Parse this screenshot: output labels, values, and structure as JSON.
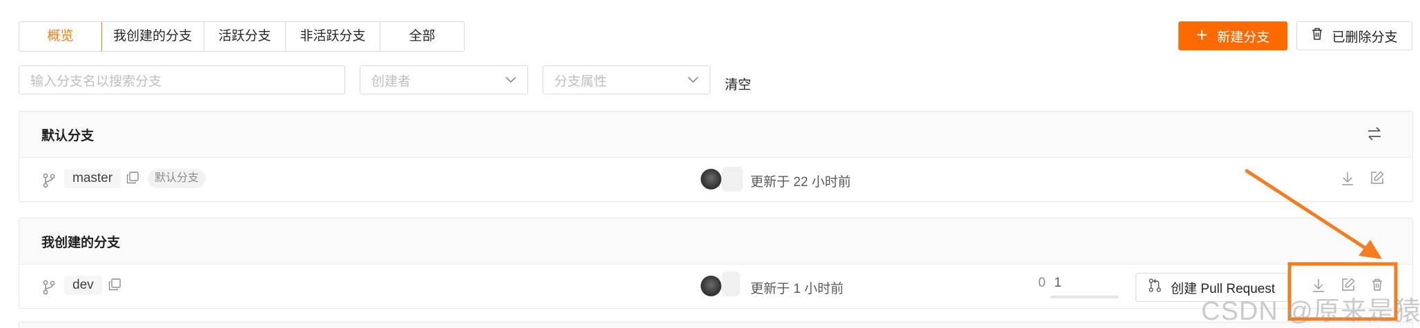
{
  "tabs": [
    {
      "label": "概览",
      "active": true
    },
    {
      "label": "我创建的分支",
      "active": false
    },
    {
      "label": "活跃分支",
      "active": false
    },
    {
      "label": "非活跃分支",
      "active": false
    },
    {
      "label": "全部",
      "active": false
    }
  ],
  "actions": {
    "new_branch": "新建分支",
    "deleted_branches": "已删除分支"
  },
  "filters": {
    "search_placeholder": "输入分支名以搜索分支",
    "creator_placeholder": "创建者",
    "attribute_placeholder": "分支属性",
    "clear": "清空"
  },
  "default_section": {
    "title": "默认分支",
    "row": {
      "branch": "master",
      "tag": "默认分支",
      "updated": "更新于 22 小时前"
    }
  },
  "mine_section": {
    "title": "我创建的分支",
    "row": {
      "branch": "dev",
      "updated": "更新于 1 小时前",
      "behind": "0",
      "ahead": "1",
      "pr_label": "创建 Pull Request"
    }
  },
  "watermark": "CSDN @原来是猿",
  "colors": {
    "accent": "#ff6a00",
    "annotation": "#f57c1f"
  }
}
